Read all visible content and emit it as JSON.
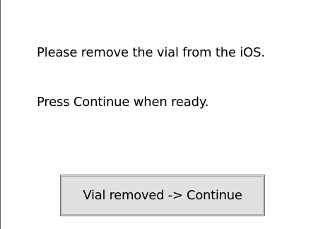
{
  "message": {
    "line1": "Please remove the vial from the iOS.",
    "line2": "Press Continue when ready."
  },
  "button": {
    "label": "Vial removed -> Continue"
  }
}
